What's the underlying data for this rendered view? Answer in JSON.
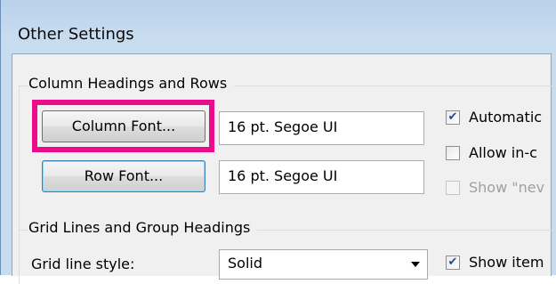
{
  "window": {
    "title": "Other Settings"
  },
  "groups": {
    "column_headings": {
      "label": "Column Headings and Rows",
      "column_font_button": "Column Font...",
      "column_font_value": "16 pt. Segoe UI",
      "row_font_button": "Row Font...",
      "row_font_value": "16 pt. Segoe UI",
      "checkboxes": [
        {
          "label": "Automatic",
          "checked": true,
          "enabled": true
        },
        {
          "label": "Allow in-c",
          "checked": false,
          "enabled": true
        },
        {
          "label": "Show \"nev",
          "checked": false,
          "enabled": false
        }
      ]
    },
    "grid_lines": {
      "label": "Grid Lines and Group Headings",
      "grid_line_style_label": "Grid line style:",
      "grid_line_style_value": "Solid",
      "show_items_label": "Show item",
      "show_items_checked": true
    }
  },
  "colors": {
    "highlight": "#ec0c8b",
    "window_frame": "#c8dcf0",
    "dialog_face": "#f0f0f0"
  },
  "icons": {
    "checkmark": "check-icon",
    "dropdown": "chevron-down-icon"
  }
}
